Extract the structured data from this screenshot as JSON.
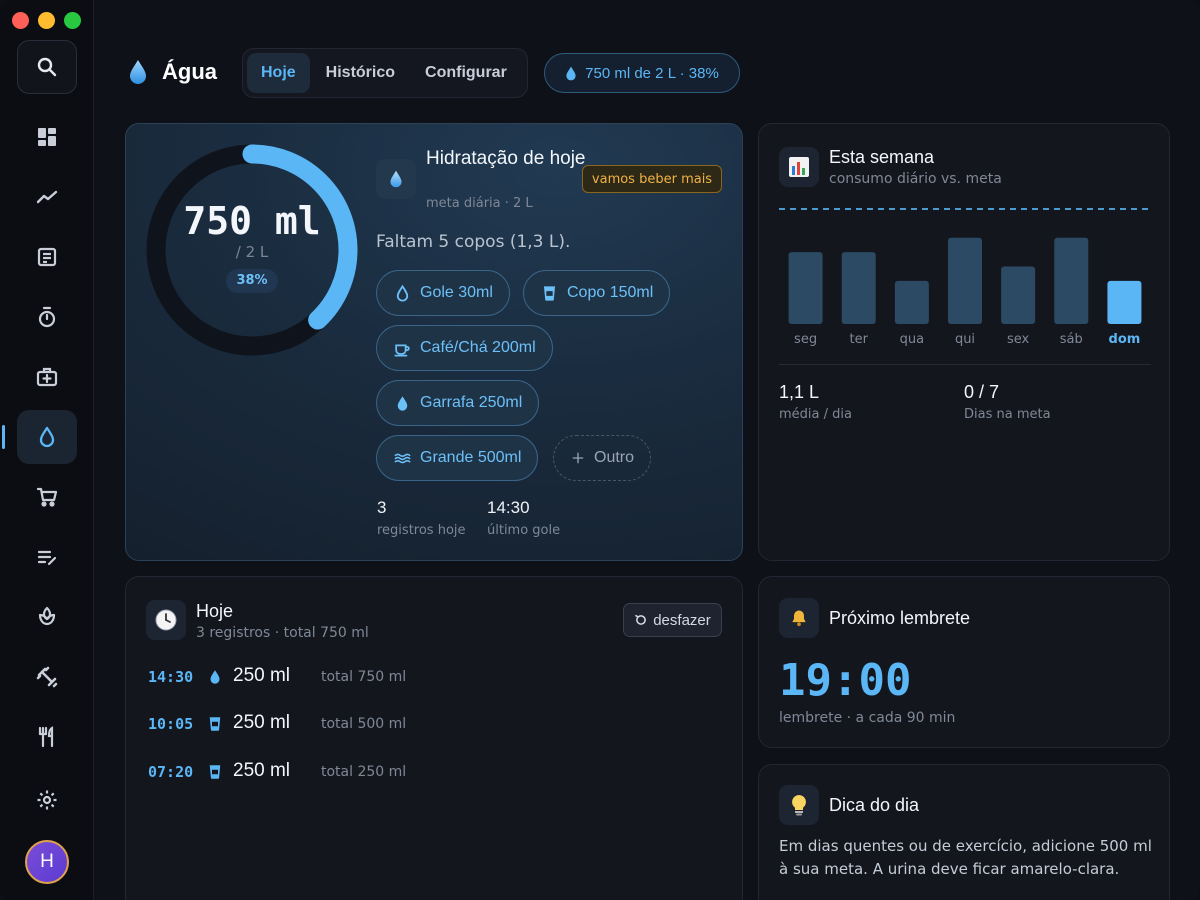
{
  "app": {
    "title": "Água",
    "accent_color": "#5bb6f5"
  },
  "tabs": [
    {
      "label": "Hoje",
      "active": true
    },
    {
      "label": "Histórico",
      "active": false
    },
    {
      "label": "Configurar",
      "active": false
    }
  ],
  "header_pill": "750 ml de 2 L · 38%",
  "sidebar": {
    "items": [
      {
        "icon": "search-icon"
      },
      {
        "icon": "dashboard-icon"
      },
      {
        "icon": "trend-icon"
      },
      {
        "icon": "notes-icon"
      },
      {
        "icon": "timer-icon"
      },
      {
        "icon": "medical-kit-icon"
      },
      {
        "icon": "water-drop-icon",
        "active": true
      },
      {
        "icon": "cart-icon"
      },
      {
        "icon": "edit-list-icon"
      },
      {
        "icon": "meditation-icon"
      },
      {
        "icon": "fitness-icon"
      },
      {
        "icon": "restaurant-icon"
      },
      {
        "icon": "settings-icon"
      }
    ],
    "avatar_initial": "H"
  },
  "hydration": {
    "value": "750 ml",
    "goal": "/ 2 L",
    "percent_label": "38%",
    "progress_fraction": 0.38,
    "title": "Hidratação de hoje",
    "subtitle": "meta diária · 2 L",
    "badge": "vamos beber mais",
    "remaining": "Faltam 5 copos (1,3 L).",
    "chips": [
      {
        "label": "Gole 30ml",
        "icon": "drop-outline-icon"
      },
      {
        "label": "Copo 150ml",
        "icon": "cup-icon"
      },
      {
        "label": "Café/Chá 200ml",
        "icon": "coffee-icon"
      },
      {
        "label": "Garrafa 250ml",
        "icon": "drop-icon"
      },
      {
        "label": "Grande 500ml",
        "icon": "waves-icon"
      },
      {
        "label": "Outro",
        "icon": "plus-icon"
      }
    ],
    "stats": [
      {
        "value": "3",
        "label": "registros hoje"
      },
      {
        "value": "14:30",
        "label": "último gole"
      }
    ]
  },
  "week": {
    "title": "Esta semana",
    "subtitle": "consumo diário vs. meta",
    "avg_value": "1,1 L",
    "avg_label": "média / dia",
    "goal_days_value": "0 / 7",
    "goal_days_label": "Dias na meta"
  },
  "chart_data": {
    "type": "bar",
    "categories": [
      "seg",
      "ter",
      "qua",
      "qui",
      "sex",
      "sáb",
      "dom"
    ],
    "values": [
      1.25,
      1.25,
      0.75,
      1.5,
      1.0,
      1.5,
      0.75
    ],
    "goal": 2,
    "ylim": [
      0,
      2
    ],
    "highlight_index": 6,
    "colors": {
      "bar": "#2c4a63",
      "highlight": "#5bb6f5",
      "goal_line": "#4b9bd3"
    }
  },
  "log": {
    "title": "Hoje",
    "subtitle": "3 registros · total 750 ml",
    "undo_label": "desfazer",
    "entries": [
      {
        "time": "14:30",
        "amount": "250 ml",
        "total": "total 750 ml",
        "icon": "drop-icon"
      },
      {
        "time": "10:05",
        "amount": "250 ml",
        "total": "total 500 ml",
        "icon": "cup-icon"
      },
      {
        "time": "07:20",
        "amount": "250 ml",
        "total": "total 250 ml",
        "icon": "cup-icon"
      }
    ]
  },
  "reminder": {
    "title": "Próximo lembrete",
    "time": "19:00",
    "caption": "lembrete · a cada 90 min"
  },
  "tip": {
    "title": "Dica do dia",
    "text": "Em dias quentes ou de exercício, adicione 500 ml à sua meta. A urina deve ficar amarelo-clara."
  }
}
